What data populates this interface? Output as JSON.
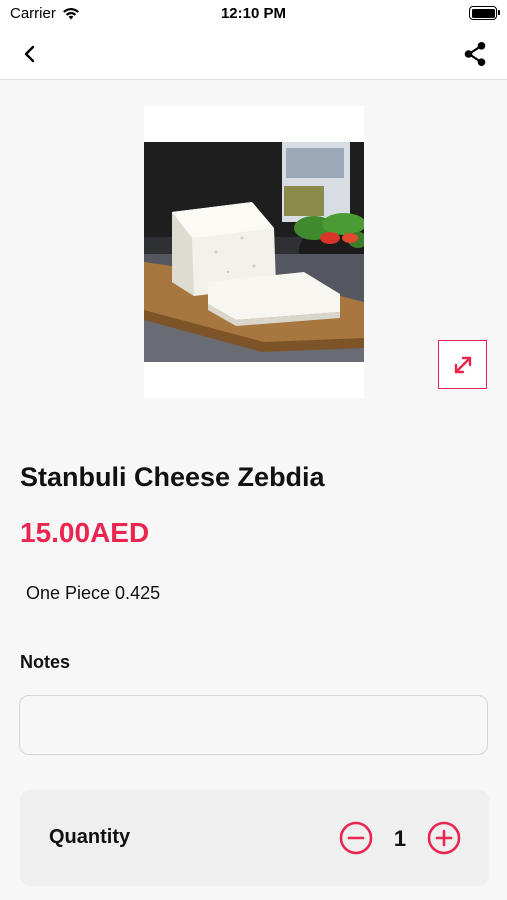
{
  "status_bar": {
    "carrier": "Carrier",
    "time": "12:10 PM"
  },
  "nav": {
    "back_icon": "chevron-left-icon",
    "share_icon": "share-icon"
  },
  "product": {
    "title": "Stanbuli Cheese Zebdia",
    "price": "15.00AED",
    "description": "One Piece 0.425",
    "image_alt": "Block of white cheese on a wooden board",
    "expand_icon": "expand-arrows-icon"
  },
  "notes": {
    "label": "Notes",
    "value": "",
    "placeholder": ""
  },
  "quantity": {
    "label": "Quantity",
    "value": "1",
    "minus_icon": "minus-circle-icon",
    "plus_icon": "plus-circle-icon"
  },
  "colors": {
    "accent": "#e8264f",
    "background": "#f7f7f7",
    "card": "#efefef"
  }
}
